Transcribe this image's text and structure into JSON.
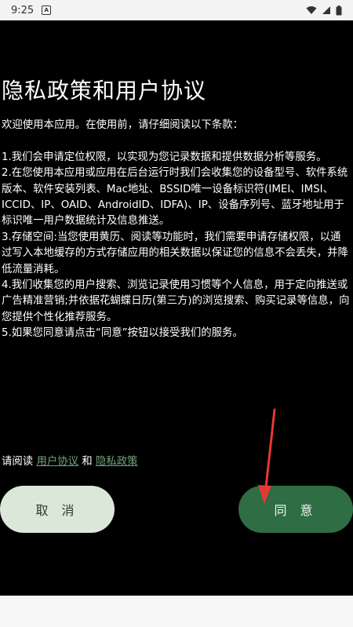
{
  "status_bar": {
    "time": "9:25",
    "notification_icon": "notification-a-icon",
    "icons": [
      "wifi-icon",
      "signal-icon",
      "battery-icon"
    ]
  },
  "dialog": {
    "title": "隐私政策和用户协议",
    "body": "欢迎使用本应用。在使用前，请仔细阅读以下条款：\n\n1.我们会申请定位权限，以实现为您记录数据和提供数据分析等服务。\n2.在您使用本应用或应用在后台运行时我们会收集您的设备型号、软件系统版本、软件安装列表、Mac地址、BSSID唯一设备标识符(IMEI、IMSI、ICCID、IP、OAID、AndroidID、IDFA)、IP、设备序列号、蓝牙地址用于标识唯一用户数据统计及信息推送。\n3.存储空间:当您使用黄历、阅读等功能时，我们需要申请存储权限，以通过写入本地缓存的方式存储应用的相关数据以保证您的信息不会丢失，并降低流量消耗。\n4.我们收集您的用户搜索、浏览记录使用习惯等个人信息，用于定向推送或广告精准营销;并依据花蝴蝶日历(第三方)的浏览搜索、购买记录等信息，向您提供个性化推荐服务。\n5.如果您同意请点击“同意”按钮以接受我们的服务。",
    "agreement_prefix": "请阅读",
    "user_agreement_link": "用户协议",
    "and_text": "和",
    "privacy_policy_link": "隐私政策",
    "cancel_label": "取 消",
    "agree_label": "同 意"
  },
  "colors": {
    "background": "#000000",
    "agree_button": "#2f6d44",
    "cancel_button": "#dbe8d9",
    "link": "#6fa37b",
    "arrow": "#e53935"
  }
}
